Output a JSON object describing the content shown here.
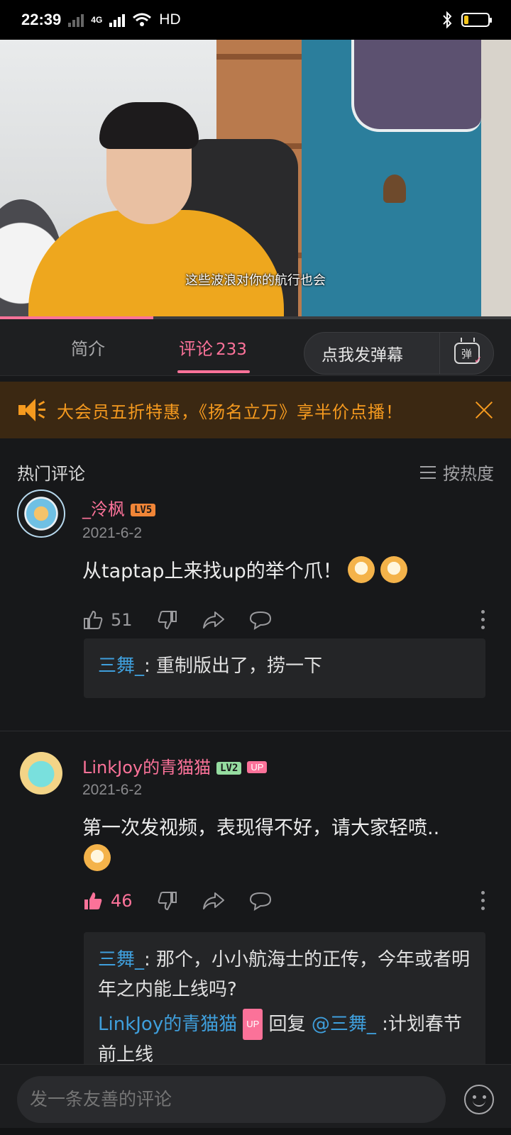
{
  "status_bar": {
    "time": "22:39",
    "network": "4G",
    "hd": "HD",
    "battery_level": 0.2,
    "colors": {
      "battery_fill": "#f3c51b"
    }
  },
  "video": {
    "subtitle": "这些波浪对你的航行也会",
    "progress": 0.3
  },
  "tabs": {
    "intro": "简介",
    "comments": "评论",
    "comment_count": "233",
    "danmaku_button": "点我发弹幕",
    "danmaku_icon_text": "弹"
  },
  "banner": {
    "text": "大会员五折特惠，《扬名立万》享半价点播！"
  },
  "comments_header": {
    "title": "热门评论",
    "sort_label": "按热度"
  },
  "comments": [
    {
      "username": "_泠枫",
      "level": "LV5",
      "date": "2021-6-2",
      "text": "从taptap上来找up的举个爪！",
      "likes": "51",
      "replies": [
        {
          "user": "三舞_",
          "text": ": 重制版出了，捞一下"
        }
      ]
    },
    {
      "username": "LinkJoy的青猫猫",
      "level": "LV2",
      "up_badge": "UP",
      "date": "2021-6-2",
      "text": "第一次发视频，表现得不好，请大家轻喷..",
      "likes": "46",
      "replies": [
        {
          "user": "三舞_",
          "text": ": 那个，小小航海士的正传，今年或者明年之内能上线吗?"
        },
        {
          "user": "LinkJoy的青猫猫",
          "badge": "UP",
          "mid": " 回复 ",
          "mention": "@三舞_",
          "text": " :计划春节前上线"
        }
      ]
    }
  ],
  "input": {
    "placeholder": "发一条友善的评论"
  },
  "colors": {
    "accent": "#fb7299",
    "banner_text": "#f59a1f",
    "reply_name": "#3f9fdc",
    "background": "#17181a"
  }
}
